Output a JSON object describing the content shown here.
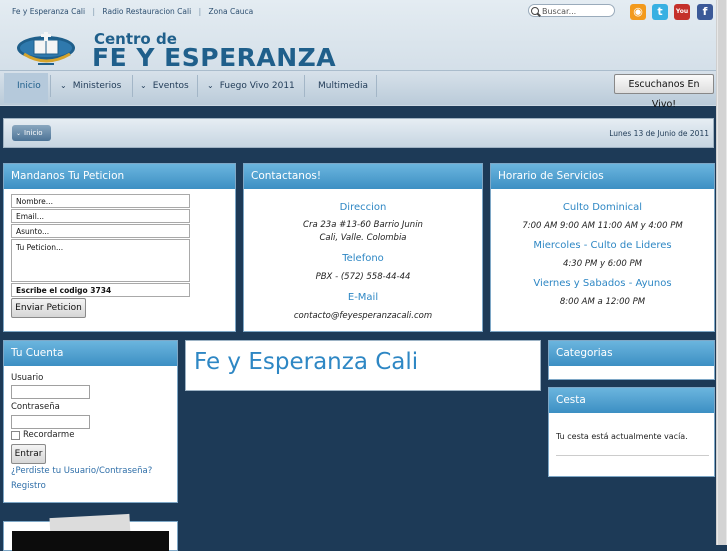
{
  "header": {
    "top_links": [
      "Fe y Esperanza Cali",
      "Radio Restauracion Cali",
      "Zona Cauca"
    ],
    "separator": "|",
    "search_placeholder": "Buscar...",
    "brand_line1": "Centro de",
    "brand_line2": "FE Y ESPERANZA",
    "social_icons": [
      "rss-icon",
      "twitter-icon",
      "youtube-icon",
      "facebook-icon"
    ],
    "social_glyphs": {
      "rss": "◉",
      "twitter": "t",
      "youtube": "You",
      "facebook": "f"
    },
    "colors": {
      "rss": "#f39a1c",
      "twitter": "#37b0e2",
      "youtube": "#c4302b",
      "facebook": "#3b5998"
    }
  },
  "nav": {
    "items": [
      {
        "label": "Inicio",
        "has_submenu": false
      },
      {
        "label": "Ministerios",
        "has_submenu": true
      },
      {
        "label": "Eventos",
        "has_submenu": true
      },
      {
        "label": "Fuego Vivo 2011",
        "has_submenu": true
      },
      {
        "label": "Multimedia",
        "has_submenu": false
      }
    ],
    "live_button": "Escuchanos En Vivo!"
  },
  "breadcrumb": {
    "label": "Inicio",
    "date": "Lunes 13 de Junio de 2011"
  },
  "request_panel": {
    "title": "Mandanos Tu Peticion",
    "name_placeholder": "Nombre...",
    "email_placeholder": "Email...",
    "subject_placeholder": "Asunto...",
    "message_placeholder": "Tu Peticion...",
    "captcha_text": "Escribe el codigo 3734",
    "submit_label": "Enviar Peticion"
  },
  "contact_panel": {
    "title": "Contactanos!",
    "address_heading": "Direccion",
    "address_line1": "Cra 23a #13-60 Barrio Junin",
    "address_line2": "Cali, Valle. Colombia",
    "phone_heading": "Telefono",
    "phone": "PBX - (572) 558-44-44",
    "email_heading": "E-Mail",
    "email": "contacto@feyesperanzacali.com"
  },
  "schedule_panel": {
    "title": "Horario de Servicios",
    "sunday_heading": "Culto Dominical",
    "sunday_times": "7:00 AM 9:00 AM 11:00 AM y 4:00 PM",
    "wednesday_heading": "Miercoles - Culto de Lideres",
    "wednesday_times": "4:30 PM y 6:00 PM",
    "friday_heading": "Viernes y Sabados - Ayunos",
    "friday_times": "8:00 AM a 12:00 PM"
  },
  "account_panel": {
    "title": "Tu Cuenta",
    "username_label": "Usuario",
    "password_label": "Contraseña",
    "remember_label": "Recordarme",
    "login_button": "Entrar",
    "forgot_link": "¿Perdiste tu Usuario/Contraseña?",
    "register_link": "Registro"
  },
  "main": {
    "title": "Fe y Esperanza Cali"
  },
  "categories_panel": {
    "title": "Categorias"
  },
  "cart_panel": {
    "title": "Cesta",
    "empty_text": "Tu cesta está actualmente vacía."
  }
}
